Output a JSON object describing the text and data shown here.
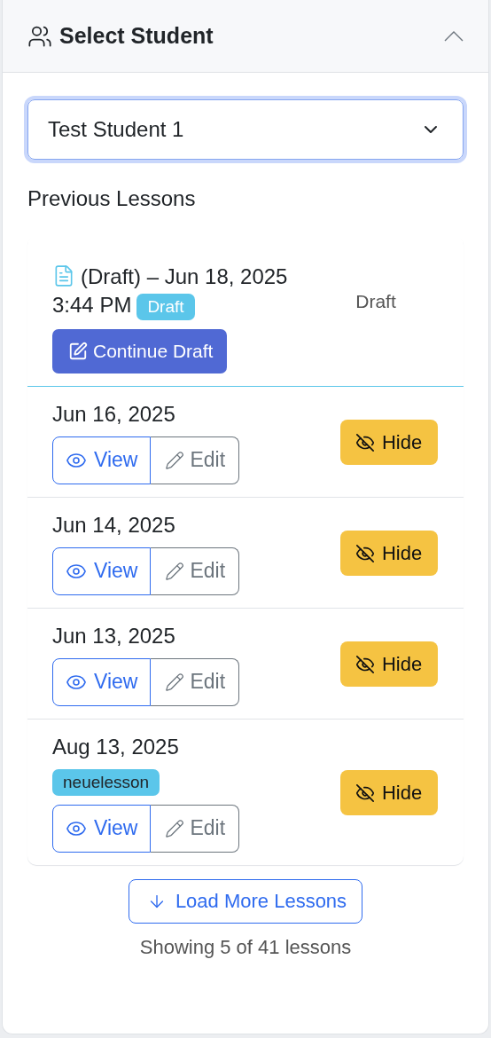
{
  "header": {
    "title": "Select Student",
    "expanded": true
  },
  "student_select": {
    "value": "Test Student 1"
  },
  "section_title": "Previous Lessons",
  "lessons": [
    {
      "kind": "draft",
      "title": "(Draft) – Jun 18, 2025 3:44 PM",
      "tag": "Draft",
      "status": "Draft",
      "action": "Continue Draft"
    },
    {
      "kind": "lesson",
      "date": "Jun 16, 2025",
      "view": "View",
      "edit": "Edit",
      "hide": "Hide"
    },
    {
      "kind": "lesson",
      "date": "Jun 14, 2025",
      "view": "View",
      "edit": "Edit",
      "hide": "Hide"
    },
    {
      "kind": "lesson",
      "date": "Jun 13, 2025",
      "view": "View",
      "edit": "Edit",
      "hide": "Hide"
    },
    {
      "kind": "lesson",
      "date": "Aug 13, 2025",
      "tag": "neuelesson",
      "view": "View",
      "edit": "Edit",
      "hide": "Hide"
    }
  ],
  "load_more": "Load More Lessons",
  "footer": "Showing 5 of 41 lessons"
}
